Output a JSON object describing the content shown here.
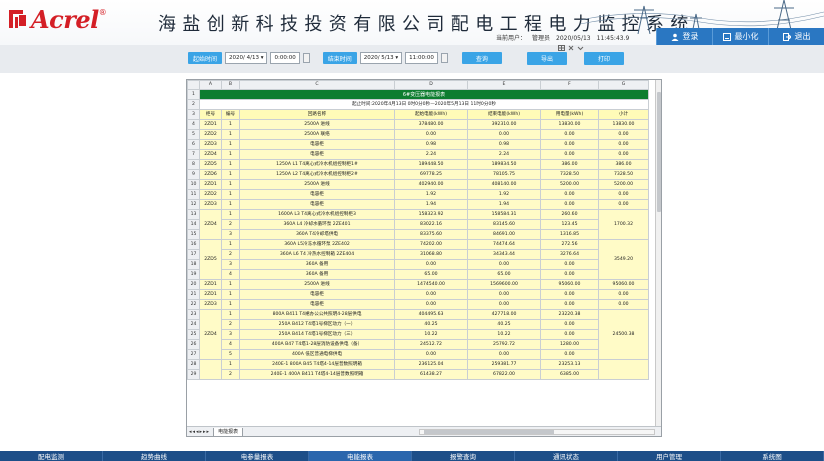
{
  "brand": {
    "logo_text": "Acrel",
    "logo_reg": "®",
    "title": "海盐创新科技投资有限公司配电工程电力监控系统"
  },
  "user_info": {
    "user_label": "当前用户：",
    "user_name": "管理员",
    "date": "2020/05/13",
    "time": "11:45:43.9"
  },
  "top_buttons": [
    {
      "label": "登录",
      "icon": "user-icon"
    },
    {
      "label": "最小化",
      "icon": "minimize-icon"
    },
    {
      "label": "退出",
      "icon": "exit-icon"
    }
  ],
  "query": {
    "start_label": "起始时间",
    "start_date": "2020/ 4/13",
    "start_time": "0:00:00",
    "end_label": "结束时间",
    "end_date": "2020/ 5/13",
    "end_time": "11:00:00",
    "query_button": "查询",
    "export_button": "导出",
    "print_button": "打印"
  },
  "sheet": {
    "col_headers": [
      "A",
      "B",
      "C",
      "D",
      "E",
      "F",
      "G"
    ],
    "title": "6#变压器电能报表",
    "subtitle": "起止时间:2020年4月13日 0时0分0秒—2020年5月13日 11时0分0秒",
    "headers": [
      "柜号",
      "编号",
      "回路名称",
      "起始电能(kWh)",
      "结束电能(kWh)",
      "用电量(kWh)",
      "小计"
    ],
    "rows": [
      {
        "r": "4",
        "a": "2ZD1",
        "b": "1",
        "c": "2500A 进线",
        "d": "378480.00",
        "e": "392310.00",
        "f": "13830.00",
        "g": "13830.00"
      },
      {
        "r": "5",
        "a": "2ZD2",
        "b": "1",
        "c": "2500A 联络",
        "d": "0.00",
        "e": "0.00",
        "f": "0.00",
        "g": "0.00"
      },
      {
        "r": "6",
        "a": "2ZD3",
        "b": "1",
        "c": "电容柜",
        "d": "0.98",
        "e": "0.98",
        "f": "0.00",
        "g": "0.00"
      },
      {
        "r": "7",
        "a": "2ZD4",
        "b": "1",
        "c": "电容柜",
        "d": "2.24",
        "e": "2.24",
        "f": "0.00",
        "g": "0.00"
      },
      {
        "r": "8",
        "a": "2ZD5",
        "b": "1",
        "c": "1250A L1 T4离心式冷水机组控制柜1#",
        "d": "189448.50",
        "e": "189834.50",
        "f": "386.00",
        "g": "386.00"
      },
      {
        "r": "9",
        "a": "2ZD6",
        "b": "1",
        "c": "1250A L2 T4离心式冷水机组控制柜2#",
        "d": "69778.25",
        "e": "78105.75",
        "f": "7328.50",
        "g": "7328.50"
      },
      {
        "r": "10",
        "a": "2ZD1",
        "b": "1",
        "c": "2500A 进线",
        "d": "402940.00",
        "e": "408140.00",
        "f": "5200.00",
        "g": "5200.00"
      },
      {
        "r": "11",
        "a": "2ZD2",
        "b": "1",
        "c": "电容柜",
        "d": "1.92",
        "e": "1.92",
        "f": "0.00",
        "g": "0.00"
      },
      {
        "r": "12",
        "a": "2ZD3",
        "b": "1",
        "c": "电容柜",
        "d": "1.94",
        "e": "1.94",
        "f": "0.00",
        "g": "0.00"
      },
      {
        "r": "13",
        "b": "1",
        "c": "1600A L3 T4离心式冷水机组控制柜3",
        "d": "158323.92",
        "e": "158584.31",
        "f": "260.60"
      },
      {
        "r": "14",
        "b": "2",
        "c": "360A L4 冷却水循环泵 2ZE401",
        "d": "83022.16",
        "e": "83145.60",
        "f": "123.45"
      },
      {
        "r": "15",
        "b": "3",
        "c": "360A T4冷却塔供电",
        "d": "83375.60",
        "e": "84691.00",
        "f": "1316.85"
      },
      {
        "r": "16",
        "b": "1",
        "c": "360A L5冷冻水循环泵 2ZE402",
        "d": "74202.00",
        "e": "74474.64",
        "f": "272.56"
      },
      {
        "r": "17",
        "b": "2",
        "c": "360A L6 T4 冷热水控制箱 2ZE404",
        "d": "31068.80",
        "e": "34343.44",
        "f": "3276.64"
      },
      {
        "r": "18",
        "b": "3",
        "c": "360A 备用",
        "d": "0.00",
        "e": "0.00",
        "f": "0.00"
      },
      {
        "r": "19",
        "b": "4",
        "c": "360A 备用",
        "d": "65.00",
        "e": "65.00",
        "f": "0.00"
      },
      {
        "r": "20",
        "a": "2ZD1",
        "b": "1",
        "c": "2500A 进线",
        "d": "1474540.00",
        "e": "1569600.00",
        "f": "95060.00",
        "g": "95060.00"
      },
      {
        "r": "21",
        "a": "2ZD1",
        "b": "1",
        "c": "电容柜",
        "d": "0.00",
        "e": "0.00",
        "f": "0.00",
        "g": "0.00"
      },
      {
        "r": "22",
        "a": "2ZD3",
        "b": "1",
        "c": "电容柜",
        "d": "0.00",
        "e": "0.00",
        "f": "0.00",
        "g": "0.00"
      },
      {
        "r": "23",
        "b": "1",
        "c": "800A B411 T4裙办公公共照明4-28层供电",
        "d": "404495.63",
        "e": "427718.00",
        "f": "23220.38"
      },
      {
        "r": "24",
        "b": "2",
        "c": "250A B412 T4塔1号梯区动力（一）",
        "d": "40.25",
        "e": "40.25",
        "f": "0.00"
      },
      {
        "r": "25",
        "b": "3",
        "c": "250A B414 T4塔1号梯区动力（三）",
        "d": "10.22",
        "e": "10.22",
        "f": "0.00"
      },
      {
        "r": "26",
        "b": "4",
        "c": "400A B47 T4塔1-28层消防设备供电（备）",
        "d": "24512.72",
        "e": "25792.72",
        "f": "1280.00"
      },
      {
        "r": "27",
        "b": "5",
        "c": "400A 低区普通电梯供电",
        "d": "0.00",
        "e": "0.00",
        "f": "0.00"
      },
      {
        "r": "28",
        "b": "1",
        "c": "240E-1 800A B45 T4塔4-14层普数照明箱",
        "d": "236125.04",
        "e": "259381.77",
        "f": "23253.13"
      },
      {
        "r": "29",
        "b": "2",
        "c": "240E-1 400A B411 T4塔4-14层普数照明箱",
        "d": "61438.27",
        "e": "67822.00",
        "f": "6385.00"
      }
    ],
    "merged": [
      {
        "a": "2ZD4",
        "g": "1700.32"
      },
      {
        "a": "2ZD5",
        "g": "3549.20"
      },
      {
        "a": "2ZD4",
        "g": "24500.38"
      },
      {
        "a": "",
        "g": ""
      }
    ],
    "tab_name": "电能报表"
  },
  "bottom_nav": [
    "配电监测",
    "趋势曲线",
    "电参量报表",
    "电能报表",
    "报警查询",
    "通讯状态",
    "用户管理",
    "系统图"
  ],
  "colors": {
    "brand_red": "#d41f26",
    "nav_blue": "#1d4e88",
    "title_green": "#0d7d2f",
    "button_blue": "#3aa4e6"
  }
}
